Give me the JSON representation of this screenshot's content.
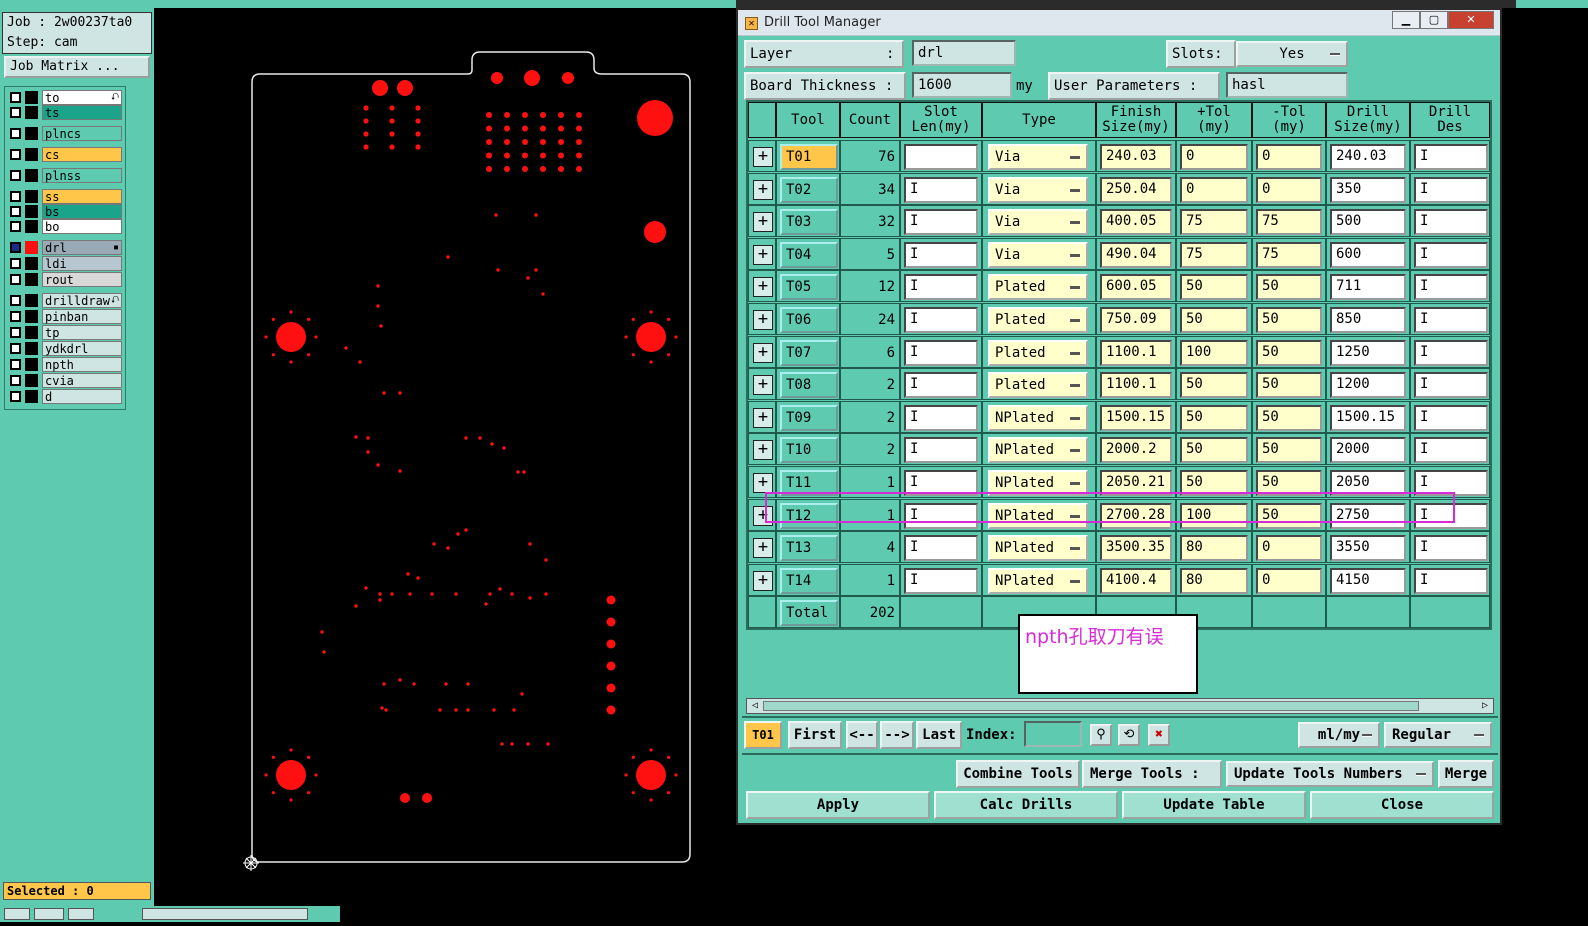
{
  "left": {
    "job": "Job : 2w00237ta0",
    "step": "Step: cam",
    "job_matrix": "Job Matrix ...",
    "layers": [
      {
        "name": "to",
        "bg": "#ffffff",
        "mark": "⮏"
      },
      {
        "name": "ts",
        "bg": "#1aa58a",
        "mark": ""
      },
      {
        "name": "plncs",
        "bg": "#5ecbb0",
        "mark": ""
      },
      {
        "name": "cs",
        "bg": "#ffc64a",
        "mark": ""
      },
      {
        "name": "plnss",
        "bg": "#5ecbb0",
        "mark": ""
      },
      {
        "name": "ss",
        "bg": "#ffc64a",
        "mark": ""
      },
      {
        "name": "bs",
        "bg": "#1aa58a",
        "mark": ""
      },
      {
        "name": "bo",
        "bg": "#ffffff",
        "mark": ""
      },
      {
        "name": "drl",
        "bg": "#9aa9b6",
        "mark": "▪"
      },
      {
        "name": "ldi",
        "bg": "#b8c6d0",
        "mark": ""
      },
      {
        "name": "rout",
        "bg": "#d8d8d8",
        "mark": ""
      },
      {
        "name": "drilldraw",
        "bg": "#cfe5e3",
        "mark": "⮏"
      },
      {
        "name": "pinban",
        "bg": "#cfe5e3",
        "mark": ""
      },
      {
        "name": "tp",
        "bg": "#cfe5e3",
        "mark": ""
      },
      {
        "name": "ydkdrl",
        "bg": "#cfe5e3",
        "mark": ""
      },
      {
        "name": "npth",
        "bg": "#cfe5e3",
        "mark": ""
      },
      {
        "name": "cvia",
        "bg": "#cfe5e3",
        "mark": ""
      },
      {
        "name": "d",
        "bg": "#cfe5e3",
        "mark": ""
      }
    ],
    "selected": "Selected : 0"
  },
  "dialog": {
    "title": "Drill Tool Manager",
    "layer_label": "Layer",
    "layer_colon": ":",
    "layer_value": "drl",
    "slots_label": "Slots:",
    "slots_value": "Yes",
    "thickness_label": "Board Thickness :",
    "thickness_value": "1600",
    "thickness_unit": "my",
    "user_params_label": "User Parameters :",
    "user_params_value": "hasl",
    "headers": [
      "Tool",
      "Count",
      "Slot\nLen(my)",
      "Type",
      "Finish\nSize(my)",
      "+Tol\n(my)",
      "-Tol\n(my)",
      "Drill\nSize(my)",
      "Drill\nDes"
    ],
    "rows": [
      {
        "tool": "T01",
        "count": "76",
        "type": "Via",
        "finish": "240.03",
        "ptol": "0",
        "mtol": "0",
        "drill": "240.03"
      },
      {
        "tool": "T02",
        "count": "34",
        "type": "Via",
        "finish": "250.04",
        "ptol": "0",
        "mtol": "0",
        "drill": "350"
      },
      {
        "tool": "T03",
        "count": "32",
        "type": "Via",
        "finish": "400.05",
        "ptol": "75",
        "mtol": "75",
        "drill": "500"
      },
      {
        "tool": "T04",
        "count": "5",
        "type": "Via",
        "finish": "490.04",
        "ptol": "75",
        "mtol": "75",
        "drill": "600"
      },
      {
        "tool": "T05",
        "count": "12",
        "type": "Plated",
        "finish": "600.05",
        "ptol": "50",
        "mtol": "50",
        "drill": "711"
      },
      {
        "tool": "T06",
        "count": "24",
        "type": "Plated",
        "finish": "750.09",
        "ptol": "50",
        "mtol": "50",
        "drill": "850"
      },
      {
        "tool": "T07",
        "count": "6",
        "type": "Plated",
        "finish": "1100.1",
        "ptol": "100",
        "mtol": "50",
        "drill": "1250"
      },
      {
        "tool": "T08",
        "count": "2",
        "type": "Plated",
        "finish": "1100.1",
        "ptol": "50",
        "mtol": "50",
        "drill": "1200"
      },
      {
        "tool": "T09",
        "count": "2",
        "type": "NPlated",
        "finish": "1500.15",
        "ptol": "50",
        "mtol": "50",
        "drill": "1500.15"
      },
      {
        "tool": "T10",
        "count": "2",
        "type": "NPlated",
        "finish": "2000.2",
        "ptol": "50",
        "mtol": "50",
        "drill": "2000"
      },
      {
        "tool": "T11",
        "count": "1",
        "type": "NPlated",
        "finish": "2050.21",
        "ptol": "50",
        "mtol": "50",
        "drill": "2050"
      },
      {
        "tool": "T12",
        "count": "1",
        "type": "NPlated",
        "finish": "2700.28",
        "ptol": "100",
        "mtol": "50",
        "drill": "2750"
      },
      {
        "tool": "T13",
        "count": "4",
        "type": "NPlated",
        "finish": "3500.35",
        "ptol": "80",
        "mtol": "0",
        "drill": "3550"
      },
      {
        "tool": "T14",
        "count": "1",
        "type": "NPlated",
        "finish": "4100.4",
        "ptol": "80",
        "mtol": "0",
        "drill": "4150"
      }
    ],
    "total_label": "Total",
    "total_value": "202",
    "annotation": "npth孔取刀有误",
    "nav": {
      "current": "T01",
      "first": "First",
      "prev": "<--",
      "next": "-->",
      "last": "Last",
      "index_label": "Index:",
      "units": "ml/my",
      "mode": "Regular"
    },
    "actions": {
      "combine": "Combine Tools",
      "merge_tools": "Merge Tools :",
      "update_numbers": "Update Tools Numbers",
      "merge": "Merge",
      "apply": "Apply",
      "calc": "Calc Drills",
      "update_table": "Update Table",
      "close": "Close"
    }
  }
}
